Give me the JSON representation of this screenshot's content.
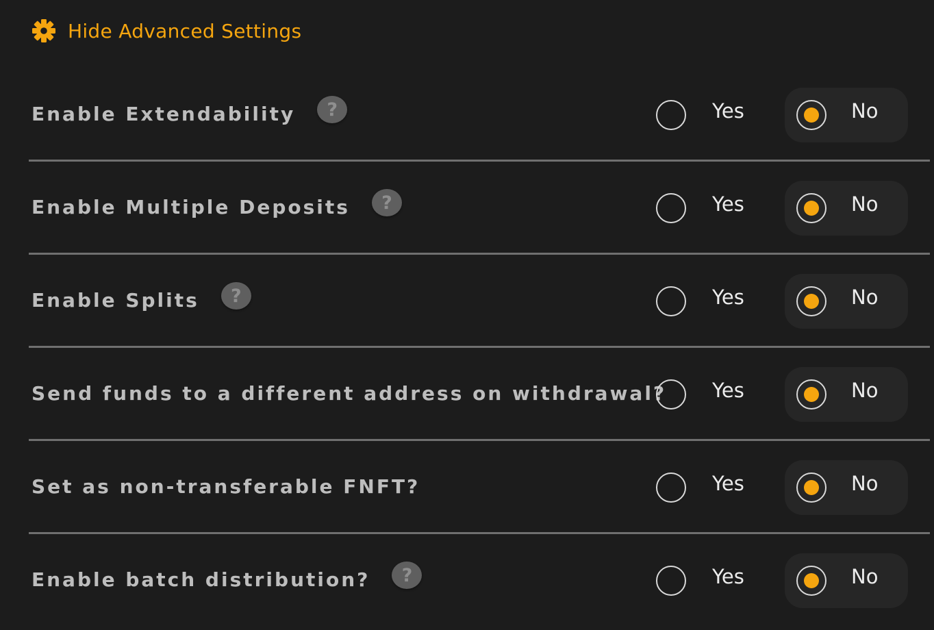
{
  "advanced_toggle": {
    "label": "Hide Advanced Settings",
    "icon": "gear-icon"
  },
  "settings": [
    {
      "label": "Enable Extendability",
      "has_help": true,
      "options": [
        "Yes",
        "No"
      ],
      "selected": "No"
    },
    {
      "label": "Enable Multiple Deposits",
      "has_help": true,
      "options": [
        "Yes",
        "No"
      ],
      "selected": "No"
    },
    {
      "label": "Enable Splits",
      "has_help": true,
      "options": [
        "Yes",
        "No"
      ],
      "selected": "No"
    },
    {
      "label": "Send funds to a different address on withdrawal?",
      "has_help": false,
      "options": [
        "Yes",
        "No"
      ],
      "selected": "No"
    },
    {
      "label": "Set as non-transferable FNFT?",
      "has_help": false,
      "options": [
        "Yes",
        "No"
      ],
      "selected": "No"
    },
    {
      "label": "Enable batch distribution?",
      "has_help": true,
      "options": [
        "Yes",
        "No"
      ],
      "selected": "No"
    }
  ],
  "help_glyph": "?",
  "colors": {
    "accent": "#f5a50f",
    "background": "#1c1c1c",
    "label": "#bdbdbd",
    "divider": "#6f6f6f"
  }
}
